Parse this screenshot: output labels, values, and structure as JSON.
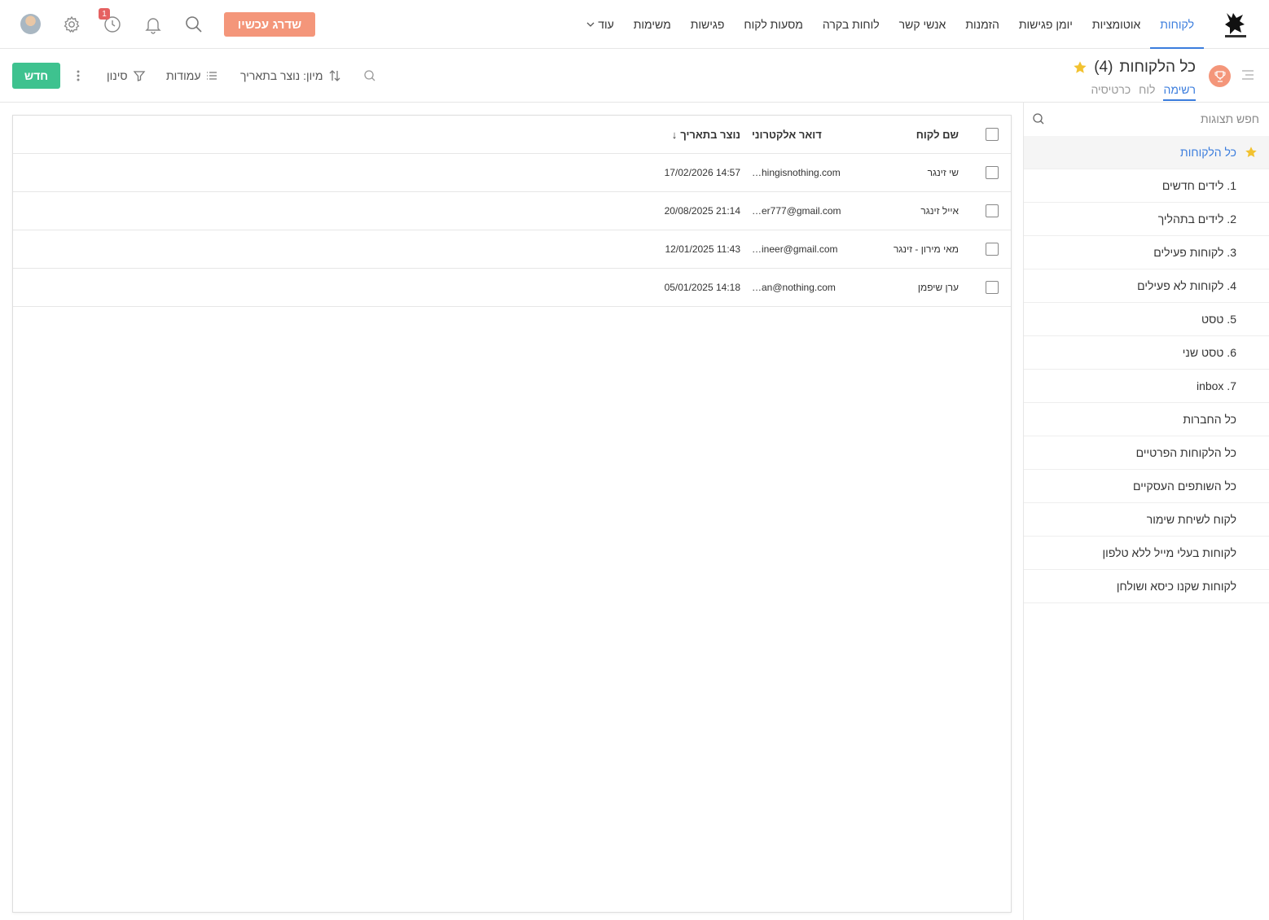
{
  "nav": {
    "items": [
      "לקוחות",
      "אוטומציות",
      "יומן פגישות",
      "הזמנות",
      "אנשי קשר",
      "לוחות בקרה",
      "מסעות לקוח",
      "פגישות",
      "משימות"
    ],
    "more_label": "עוד",
    "upgrade_label": "שדרג עכשיו",
    "history_badge": "1"
  },
  "header": {
    "title": "כל הלקוחות",
    "count": "(4)",
    "tabs": [
      "רשימה",
      "לוח",
      "כרטיסיה"
    ],
    "sort_label": "מיון: נוצר בתאריך",
    "columns_label": "עמודות",
    "filter_label": "סינון",
    "new_label": "חדש"
  },
  "sidebar": {
    "search_placeholder": "חפש תצוגות",
    "items": [
      "כל הלקוחות",
      "1. לידים חדשים",
      "2. לידים בתהליך",
      "3. לקוחות פעילים",
      "4. לקוחות לא פעילים",
      "5. טסט",
      "6. טסט שני",
      "7. inbox",
      "כל החברות",
      "כל הלקוחות הפרטיים",
      "כל השותפים העסקיים",
      "לקוח לשיחת שימור",
      "לקוחות בעלי מייל ללא טלפון",
      "לקוחות שקנו כיסא ושולחן"
    ]
  },
  "table": {
    "columns": [
      "שם לקוח",
      "דואר אלקטרוני",
      "נוצר בתאריך"
    ],
    "sort_arrow": "↓",
    "rows": [
      {
        "name": "שי זינגר",
        "email": "…hingisnothing.com",
        "created": "14:57 17/02/2026"
      },
      {
        "name": "אייל זינגר",
        "email": "…er777@gmail.com",
        "created": "21:14 20/08/2025"
      },
      {
        "name": "מאי מירון - זינגר",
        "email": "…ineer@gmail.com",
        "created": "11:43 12/01/2025"
      },
      {
        "name": "ערן שיפמן",
        "email": "…an@nothing.com",
        "created": "14:18 05/01/2025"
      }
    ]
  },
  "colors": {
    "accent": "#3b7ddd",
    "upgrade": "#f4967a",
    "new_button": "#3ec28f",
    "star": "#f2c230",
    "badge": "#e56161"
  }
}
